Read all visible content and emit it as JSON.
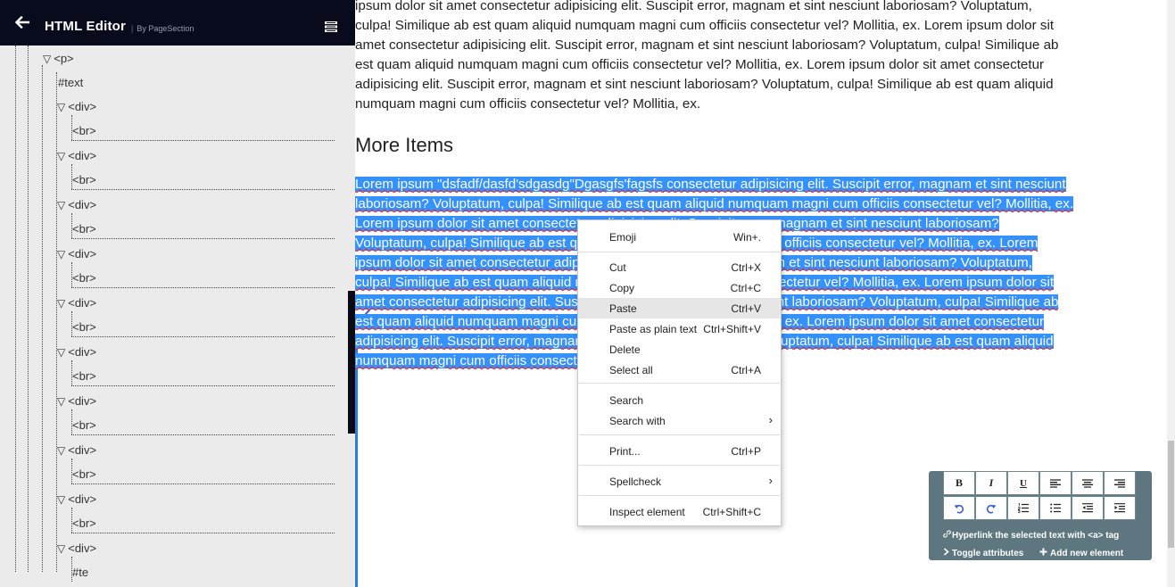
{
  "sidebar": {
    "title": "HTML Editor",
    "subtitle_sep": "|",
    "subtitle": "By PageSection",
    "tree": {
      "p_node": "<p>",
      "text_node": "#text",
      "div_nodes": [
        "<div>",
        "<div>",
        "<div>",
        "<div>",
        "<div>",
        "<div>",
        "<div>",
        "<div>",
        "<div>",
        "<div>"
      ],
      "br_nodes": [
        "<br>",
        "<br>",
        "<br>",
        "<br>",
        "<br>",
        "<br>",
        "<br>",
        "<br>",
        "<br>"
      ],
      "partial_node": "#te"
    }
  },
  "content": {
    "para1_lines": [
      "ipsum dolor sit amet consectetur adipisicing elit. Suscipit error, magnam et sint nesciunt laboriosam? Voluptatum,",
      "culpa! Similique ab est quam aliquid numquam magni cum officiis consectetur vel? Mollitia, ex. Lorem ipsum dolor sit",
      "amet consectetur adipisicing elit. Suscipit error, magnam et sint nesciunt laboriosam? Voluptatum, culpa! Similique ab",
      "est quam aliquid numquam magni cum officiis consectetur vel? Mollitia, ex. Lorem ipsum dolor sit amet consectetur",
      "adipisicing elit. Suscipit error, magnam et sint nesciunt laboriosam? Voluptatum, culpa! Similique ab est quam aliquid",
      "numquam magni cum officiis consectetur vel? Mollitia, ex."
    ],
    "heading": "More Items",
    "selected_lines": [
      "Lorem ipsum \"dsfadf/dasfd'sdgasdg\"Dgasgfs'fagsfs consectetur adipisicing elit. Suscipit error, magnam et sint nesciunt",
      "laboriosam? Voluptatum, culpa! Similique ab est quam aliquid numquam magni cum officiis consectetur vel? Mollitia, ex.",
      "Lorem ipsum dolor sit amet consectetur adipisicing elit. Suscipit error, magnam et sint nesciunt laboriosam?",
      "Voluptatum, culpa! Similique ab est quam aliquid numquam magni cum officiis consectetur vel? Mollitia, ex. Lorem",
      "ipsum dolor sit amet consectetur adipisicing elit. Suscipit error, magnam et sint nesciunt laboriosam? Voluptatum,",
      "culpa! Similique ab est quam aliquid numquam magni cum officiis consectetur vel? Mollitia, ex. Lorem ipsum dolor sit",
      "amet consectetur adipisicing elit. Suscipit error, magnam et sint nesciunt laboriosam? Voluptatum, culpa! Similique ab",
      "est quam aliquid numquam magni cum officiis consectetur vel? Mollitia, ex. Lorem ipsum dolor sit amet consectetur",
      "adipisicing elit. Suscipit error, magnam et sint nesciunt laboriosam? Voluptatum, culpa! Similique ab est quam aliquid",
      "numquam magni cum officiis consectetur vel? Mollitia, ex."
    ],
    "selection_color": "#3392ff"
  },
  "context_menu": {
    "items": [
      {
        "label": "Emoji",
        "shortcut": "Win+."
      },
      {
        "label": "Cut",
        "shortcut": "Ctrl+X"
      },
      {
        "label": "Copy",
        "shortcut": "Ctrl+C"
      },
      {
        "label": "Paste",
        "shortcut": "Ctrl+V"
      },
      {
        "label": "Paste as plain text",
        "shortcut": "Ctrl+Shift+V"
      },
      {
        "label": "Delete",
        "shortcut": ""
      },
      {
        "label": "Select all",
        "shortcut": "Ctrl+A"
      },
      {
        "label": "Search",
        "shortcut": ""
      },
      {
        "label": "Search with",
        "shortcut": ""
      },
      {
        "label": "Print...",
        "shortcut": "Ctrl+P"
      },
      {
        "label": "Spellcheck",
        "shortcut": ""
      },
      {
        "label": "Inspect element",
        "shortcut": "Ctrl+Shift+C"
      }
    ],
    "highlighted": "Paste"
  },
  "toolbar": {
    "bold": "B",
    "italic": "I",
    "underline": "U",
    "hyperlink_label": "Hyperlink the selected text with <a> tag",
    "toggle_attributes_label": "Toggle attributes",
    "add_element_label": "Add new element",
    "icons": [
      "bold-icon",
      "italic-icon",
      "underline-icon",
      "align-left-icon",
      "align-center-icon",
      "align-right-icon",
      "undo-icon",
      "redo-icon",
      "ordered-list-icon",
      "unordered-list-icon",
      "outdent-icon",
      "indent-icon"
    ]
  }
}
